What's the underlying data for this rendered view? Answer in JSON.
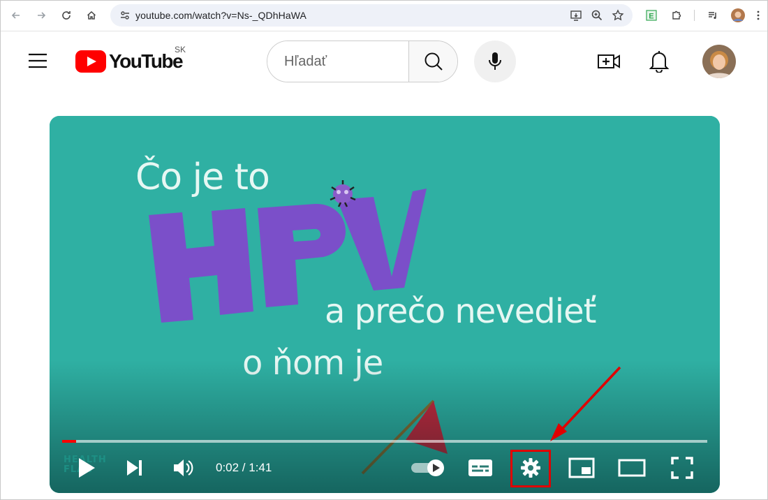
{
  "browser": {
    "url": "youtube.com/watch?v=Ns-_QDhHaWA",
    "back_icon": "arrow-left-icon",
    "forward_icon": "arrow-right-icon",
    "reload_icon": "reload-icon",
    "home_icon": "home-icon"
  },
  "header": {
    "logo_text": "YouTube",
    "country_code": "SK",
    "search_placeholder": "Hľadať"
  },
  "video": {
    "line1": "Čo je to",
    "big_title": "HPV",
    "line2": "a prečo nevedieť",
    "line3": "o ňom je",
    "watermark_line1": "HEALTH",
    "watermark_line2": "FLAG",
    "time_display": "0:02 / 1:41",
    "progress_fraction": 0.022,
    "colors": {
      "background": "#2fb0a3",
      "title": "#e6f7f3",
      "hpv": "#7b4fc9",
      "progress": "#ff0000",
      "highlight": "#e00000"
    }
  }
}
